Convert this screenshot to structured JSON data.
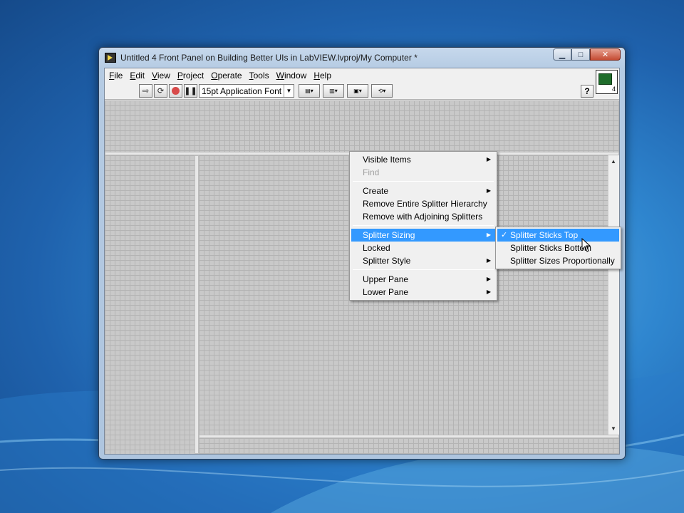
{
  "window": {
    "title": "Untitled 4 Front Panel on Building Better UIs in LabVIEW.lvproj/My Computer *",
    "minimize_glyph": "▁",
    "maximize_glyph": "□",
    "close_glyph": "✕"
  },
  "menubar": {
    "items": [
      {
        "label": "File",
        "accel": "F"
      },
      {
        "label": "Edit",
        "accel": "E"
      },
      {
        "label": "View",
        "accel": "V"
      },
      {
        "label": "Project",
        "accel": "P"
      },
      {
        "label": "Operate",
        "accel": "O"
      },
      {
        "label": "Tools",
        "accel": "T"
      },
      {
        "label": "Window",
        "accel": "W"
      },
      {
        "label": "Help",
        "accel": "H"
      }
    ]
  },
  "toolbar": {
    "font_select_value": "15pt Application Font",
    "help_glyph": "?",
    "vi_icon_number": "4",
    "icons": [
      "run-arrow-icon",
      "run-continuously-icon",
      "abort-icon",
      "pause-icon",
      "align-objects-icon",
      "distribute-objects-icon",
      "resize-objects-icon",
      "reorder-icon"
    ]
  },
  "context_menu": {
    "groups": [
      [
        {
          "label": "Visible Items",
          "submenu": true,
          "enabled": true
        },
        {
          "label": "Find",
          "submenu": false,
          "enabled": false
        }
      ],
      [
        {
          "label": "Create",
          "submenu": true,
          "enabled": true
        },
        {
          "label": "Remove Entire Splitter Hierarchy",
          "submenu": false,
          "enabled": true
        },
        {
          "label": "Remove with Adjoining Splitters",
          "submenu": false,
          "enabled": true
        }
      ],
      [
        {
          "label": "Splitter Sizing",
          "submenu": true,
          "enabled": true,
          "selected": true
        },
        {
          "label": "Locked",
          "submenu": false,
          "enabled": true
        },
        {
          "label": "Splitter Style",
          "submenu": true,
          "enabled": true
        }
      ],
      [
        {
          "label": "Upper Pane",
          "submenu": true,
          "enabled": true
        },
        {
          "label": "Lower Pane",
          "submenu": true,
          "enabled": true
        }
      ]
    ]
  },
  "submenu": {
    "items": [
      {
        "label": "Splitter Sticks Top",
        "checked": true,
        "selected": true
      },
      {
        "label": "Splitter Sticks Bottom",
        "checked": false,
        "selected": false
      },
      {
        "label": "Splitter Sizes Proportionally",
        "checked": false,
        "selected": false
      }
    ],
    "check_glyph": "✓"
  }
}
